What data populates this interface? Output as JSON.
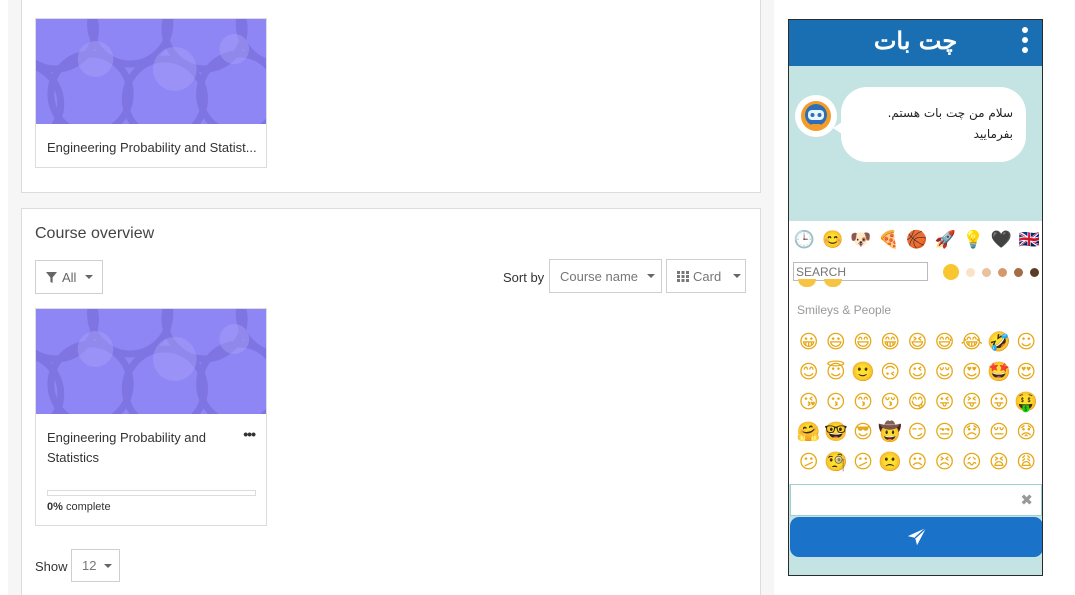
{
  "colors": {
    "accent": "#1177d1",
    "chat_header": "#1a6fb3",
    "chat_background": "#c4e4e4",
    "course_image": "#8f86f5",
    "send_button": "#1a72c9"
  },
  "top_panel": {
    "course_card": {
      "title": "Engineering Probability and Statist..."
    }
  },
  "course_overview": {
    "heading": "Course overview",
    "filter": {
      "label": "All",
      "icon": "filter-icon"
    },
    "sort": {
      "label": "Sort by",
      "value": "Course name"
    },
    "view": {
      "label": "Card",
      "icon": "grid-icon"
    },
    "course_card": {
      "title": "Engineering Probability and Statistics",
      "menu": "•••",
      "progress": {
        "percent": 0,
        "value_text": "0%",
        "suffix": " complete"
      }
    },
    "show": {
      "label": "Show",
      "value": "12"
    }
  },
  "chat": {
    "title": "چت بات",
    "menu_icon": "kebab-menu-icon",
    "bot_avatar_icon": "robot-icon",
    "message": {
      "line1": "سلام من چت بات هستم.",
      "line2": "بفرمایید"
    },
    "emoji_picker": {
      "categories": [
        {
          "name": "recent",
          "glyph": "🕒"
        },
        {
          "name": "smileys",
          "glyph": "😊"
        },
        {
          "name": "animals",
          "glyph": "🐶"
        },
        {
          "name": "food",
          "glyph": "🍕"
        },
        {
          "name": "activity",
          "glyph": "🏀"
        },
        {
          "name": "travel",
          "glyph": "🚀"
        },
        {
          "name": "objects",
          "glyph": "💡"
        },
        {
          "name": "symbols",
          "glyph": "🖤"
        },
        {
          "name": "flags",
          "glyph": "🇬🇧"
        }
      ],
      "search_placeholder": "SEARCH",
      "skin_tones": [
        "#f8c630",
        "#fbe1c6",
        "#e8c19e",
        "#d59a6c",
        "#a36d45",
        "#5d3c27"
      ],
      "category_label": "Smileys & People",
      "emojis": [
        "😀",
        "😃",
        "😄",
        "😁",
        "😆",
        "😅",
        "😂",
        "🤣",
        "☺",
        "😊",
        "😇",
        "🙂",
        "🙃",
        "😉",
        "😌",
        "😍",
        "🤩",
        "😍",
        "😘",
        "😗",
        "😙",
        "😚",
        "😋",
        "😜",
        "😝",
        "😛",
        "🤑",
        "🤗",
        "🤓",
        "😎",
        "🤠",
        "😏",
        "😒",
        "😞",
        "😔",
        "😟",
        "😕",
        "🧐",
        "😕",
        "🙁",
        "☹",
        "😣",
        "😖",
        "😫",
        "😩"
      ]
    },
    "input": {
      "value": "",
      "clear_icon": "✖"
    },
    "send_icon": "send-icon"
  }
}
